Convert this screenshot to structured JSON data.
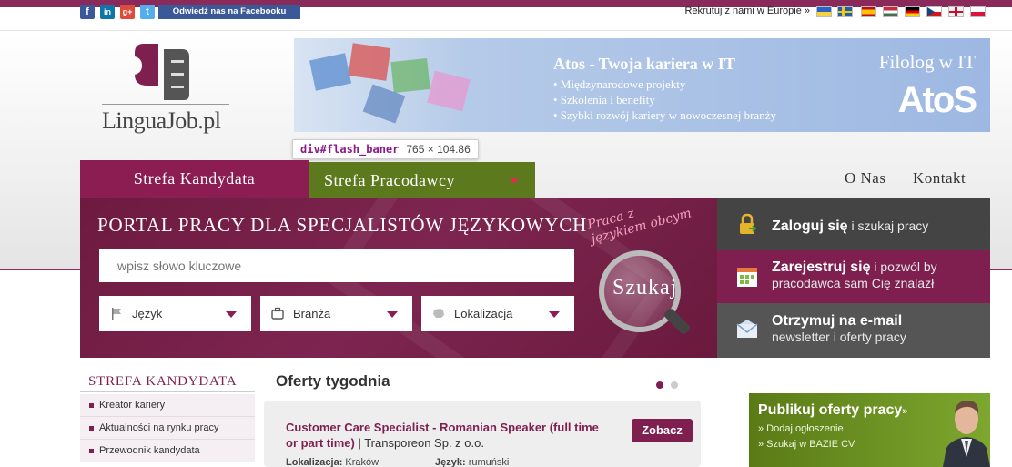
{
  "utility": {
    "social": [
      "f",
      "in",
      "g+",
      "t"
    ],
    "facebook_btn": "Odwiedź nas na Facebooku",
    "europe": "Rekrutuj z nami w Europie »",
    "flags": [
      {
        "name": "ukraine",
        "colors": [
          "#2a62c9",
          "#f7d23b"
        ]
      },
      {
        "name": "sweden",
        "colors": [
          "#1e5fb0",
          "#f5c518"
        ]
      },
      {
        "name": "spain",
        "colors": [
          "#c60b1e",
          "#ffc400"
        ]
      },
      {
        "name": "hungary",
        "colors": [
          "#cd2a3e",
          "#436f4d"
        ]
      },
      {
        "name": "germany",
        "colors": [
          "#000000",
          "#dd0000"
        ]
      },
      {
        "name": "czech",
        "colors": [
          "#11457e",
          "#d7141a"
        ]
      },
      {
        "name": "uk",
        "colors": [
          "#012169",
          "#c8102e"
        ]
      },
      {
        "name": "poland",
        "colors": [
          "#ffffff",
          "#dc143c"
        ]
      }
    ]
  },
  "logo": {
    "text": "LinguaJob.pl"
  },
  "banner": {
    "title": "Atos - Twoja kariera w IT",
    "bullets": [
      "• Międzynarodowe projekty",
      "• Szkolenia i benefity",
      "• Szybki rozwój kariery w nowoczesnej branży"
    ],
    "filolog": "Filolog w IT",
    "brand": "AtoS"
  },
  "tooltip": {
    "selector": "div#flash_baner",
    "dims": "765 × 104.86"
  },
  "tabs": {
    "candidate": "Strefa Kandydata",
    "employer": "Strefa Pracodawcy"
  },
  "nav": {
    "about": "O Nas",
    "contact": "Kontakt"
  },
  "hero": {
    "title": "PORTAL PRACY DLA SPECJALISTÓW JĘZYKOWYCH",
    "search_placeholder": "wpisz słowo kluczowe",
    "dropdowns": [
      "Język",
      "Branża",
      "Lokalizacja"
    ],
    "slogan_line1": "Praca z",
    "slogan_line2": "językiem obcym",
    "search_button": "Szukaj"
  },
  "panel": {
    "login_bold": "Zaloguj się",
    "login_rest": " i szukaj pracy",
    "register_bold": "Zarejestruj się",
    "register_rest1": " i pozwól by",
    "register_rest2": "pracodawca sam Cię znalazł",
    "newsletter_bold": "Otrzymuj na e-mail",
    "newsletter_rest": "newsletter i oferty pracy"
  },
  "sidebar": {
    "title": "Strefa kandydata",
    "items": [
      "Kreator kariery",
      "Aktualności na rynku pracy",
      "Przewodnik kandydata"
    ]
  },
  "offers": {
    "heading": "Oferty tygodnia",
    "job_title": "Customer Care Specialist - Romanian Speaker (full time or part time)",
    "company": " | Transporeon Sp. z o.o.",
    "button": "Zobacz",
    "location_label": "Lokalizacja:",
    "location_value": " Kraków",
    "language_label": "Język:",
    "language_value": " rumuński"
  },
  "publish": {
    "title": "Publikuj oferty pracy",
    "title_suffix": "»",
    "links": [
      "» Dodaj ogłoszenie",
      "» Szukaj w BAZIE CV"
    ]
  },
  "colors": {
    "brand": "#7e1f4f",
    "green": "#5c7a1d",
    "dark": "#444444"
  }
}
